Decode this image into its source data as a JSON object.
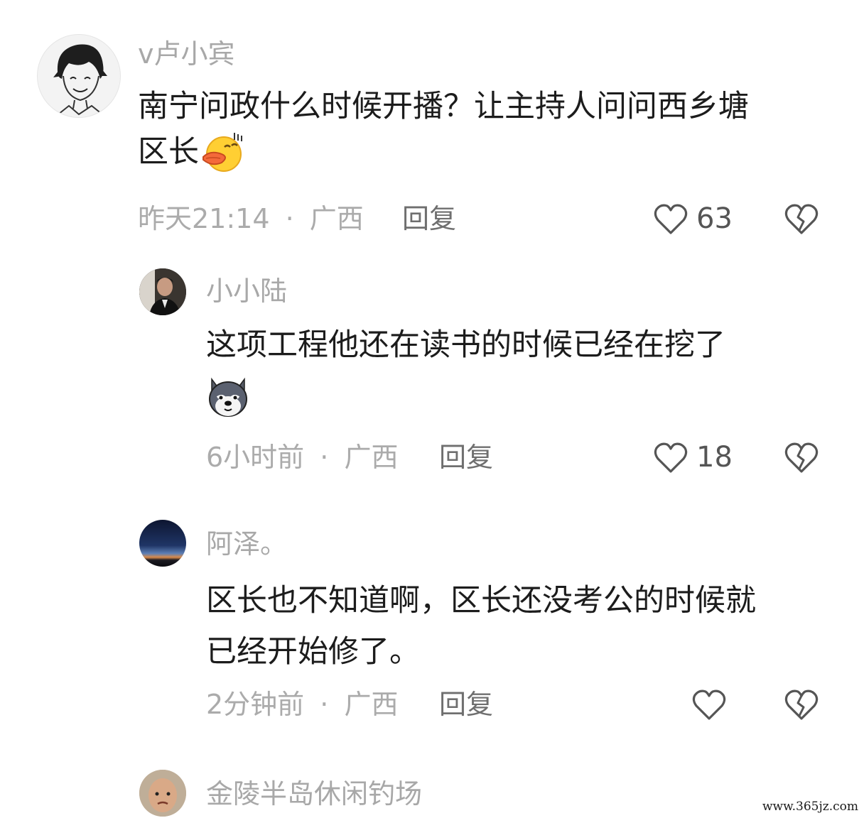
{
  "comments": [
    {
      "username": "v卢小宾",
      "text_line1": "南宁问政什么时候开播？让主持人问问西乡塘",
      "text_line2": "区长",
      "emoji_icon": "duck-lips-emoji-icon",
      "time": "昨天21:14",
      "separator": "·",
      "location": "广西",
      "reply_label": "回复",
      "like_count": "63"
    },
    {
      "username": "小小陆",
      "text_line1": "这项工程他还在读书的时候已经在挖了",
      "emoji_icon": "husky-dog-emoji-icon",
      "time": "6小时前",
      "separator": "·",
      "location": "广西",
      "reply_label": "回复",
      "like_count": "18"
    },
    {
      "username": "阿泽。",
      "text_line1": "区长也不知道啊，区长还没考公的时候就",
      "text_line2": "已经开始修了。",
      "time": "2分钟前",
      "separator": "·",
      "location": "广西",
      "reply_label": "回复",
      "like_count": ""
    },
    {
      "username": "金陵半岛休闲钓场"
    }
  ],
  "icons": {
    "like": "heart-outline-icon",
    "dislike": "broken-heart-icon"
  },
  "watermark": "www.365jz.com",
  "colors": {
    "username": "#a8a8a8",
    "body_text": "#1c1c1c",
    "meta": "#ababab",
    "reply": "#6f6f6f",
    "icon_stroke": "#555555"
  }
}
